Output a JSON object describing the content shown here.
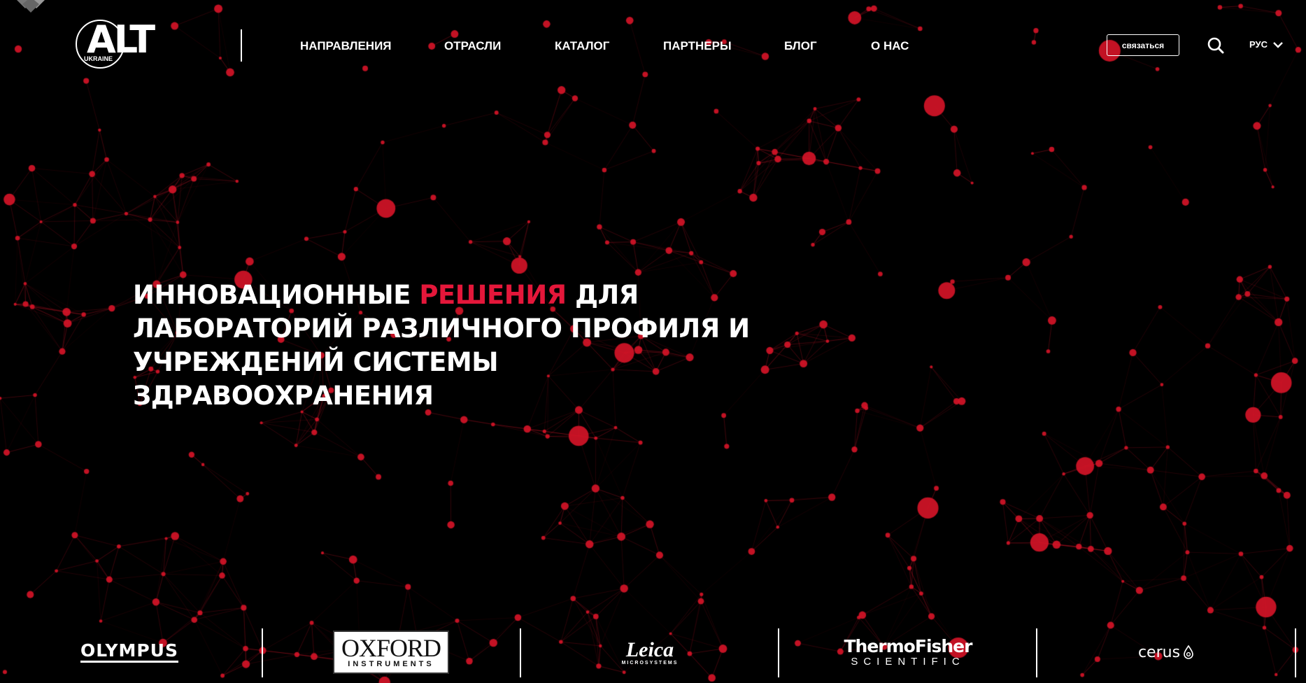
{
  "header": {
    "logo_text": "ALT",
    "logo_sub": "UKRAINE",
    "nav": [
      "НАПРАВЛЕНИЯ",
      "ОТРАСЛИ",
      "КАТАЛОГ",
      "ПАРТНЕРЫ",
      "БЛОГ",
      "О НАС"
    ],
    "contact_label": "связаться",
    "language": "РУС"
  },
  "hero": {
    "pre": "ИННОВАЦИОННЫЕ",
    "accent": "РЕШЕНИЯ",
    "post": "ДЛЯ ЛАБОРАТОРИЙ РАЗЛИЧНОГО ПРОФИЛЯ И УЧРЕЖДЕНИЙ СИСТЕМЫ ЗДРАВООХРАНЕНИЯ"
  },
  "partners": [
    {
      "name": "OLYMPUS"
    },
    {
      "name": "OXFORD",
      "sub": "INSTRUMENTS"
    },
    {
      "name": "Leica",
      "sub": "MICROSYSTEMS"
    },
    {
      "name": "ThermoFisher",
      "sub": "SCIENTIFIC"
    },
    {
      "name": "cerus"
    }
  ],
  "colors": {
    "background": "#000000",
    "accent": "#e4173a",
    "network": "#d3122b",
    "text": "#ffffff"
  },
  "icons": [
    "search-icon",
    "chevron-down-icon"
  ]
}
